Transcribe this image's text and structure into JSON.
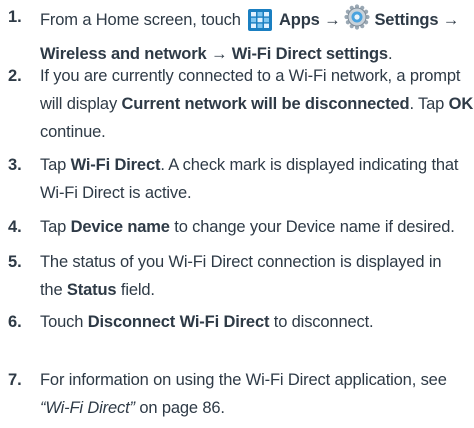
{
  "steps": [
    {
      "number": "1.",
      "lines": [
        {
          "segments": [
            {
              "text": "From a Home screen, touch ",
              "style": "normal"
            },
            {
              "icon": "apps-grid-icon",
              "color": "#1a7fc1"
            },
            {
              "text": " Apps ",
              "style": "bold"
            },
            {
              "text": "→",
              "style": "bold"
            },
            {
              "icon": "settings-gear-icon"
            },
            {
              "text": "Settings ",
              "style": "bold"
            },
            {
              "text": "→",
              "style": "bold"
            }
          ]
        },
        {
          "segments": [
            {
              "text": "Wireless and network ",
              "style": "bold"
            },
            {
              "text": "→",
              "style": "bold"
            },
            {
              "text": " Wi-Fi Direct settings",
              "style": "bold"
            },
            {
              "text": ".",
              "style": "normal"
            }
          ]
        }
      ]
    },
    {
      "number": "2.",
      "lines": [
        {
          "segments": [
            {
              "text": "If you are currently connected to a Wi-Fi network, a prompt",
              "style": "normal"
            }
          ]
        },
        {
          "segments": [
            {
              "text": "will display ",
              "style": "normal"
            },
            {
              "text": "Current network will be disconnected",
              "style": "bold"
            },
            {
              "text": ". Tap ",
              "style": "normal"
            },
            {
              "text": "OK",
              "style": "bold"
            },
            {
              "text": " to",
              "style": "normal"
            }
          ]
        },
        {
          "segments": [
            {
              "text": "continue.",
              "style": "normal"
            }
          ]
        }
      ]
    },
    {
      "number": "3.",
      "lines": [
        {
          "segments": [
            {
              "text": "Tap ",
              "style": "normal"
            },
            {
              "text": "Wi-Fi Direct",
              "style": "bold"
            },
            {
              "text": ". A check mark is displayed indicating that",
              "style": "normal"
            }
          ]
        },
        {
          "segments": [
            {
              "text": "Wi-Fi Direct is active.",
              "style": "normal"
            }
          ]
        }
      ]
    },
    {
      "number": "4.",
      "lines": [
        {
          "segments": [
            {
              "text": "Tap ",
              "style": "normal"
            },
            {
              "text": "Device name",
              "style": "bold"
            },
            {
              "text": " to change your Device name if desired.",
              "style": "normal"
            }
          ]
        }
      ]
    },
    {
      "number": "5.",
      "lines": [
        {
          "segments": [
            {
              "text": "The status of you Wi-Fi Direct connection is displayed in",
              "style": "normal"
            }
          ]
        },
        {
          "segments": [
            {
              "text": "the ",
              "style": "normal"
            },
            {
              "text": "Status",
              "style": "bold"
            },
            {
              "text": " field.",
              "style": "normal"
            }
          ]
        }
      ]
    },
    {
      "number": "6.",
      "lines": [
        {
          "segments": [
            {
              "text": "Touch ",
              "style": "normal"
            },
            {
              "text": "Disconnect Wi-Fi Direct",
              "style": "bold"
            },
            {
              "text": " to disconnect.",
              "style": "normal"
            }
          ]
        }
      ]
    },
    {
      "number": "7.",
      "lines": [
        {
          "segments": [
            {
              "text": "For information on using the Wi-Fi Direct application, see",
              "style": "normal"
            }
          ]
        },
        {
          "segments": [
            {
              "text": "“Wi-Fi Direct”",
              "style": "italic"
            },
            {
              "text": " on page 86.",
              "style": "normal"
            }
          ]
        }
      ]
    }
  ]
}
